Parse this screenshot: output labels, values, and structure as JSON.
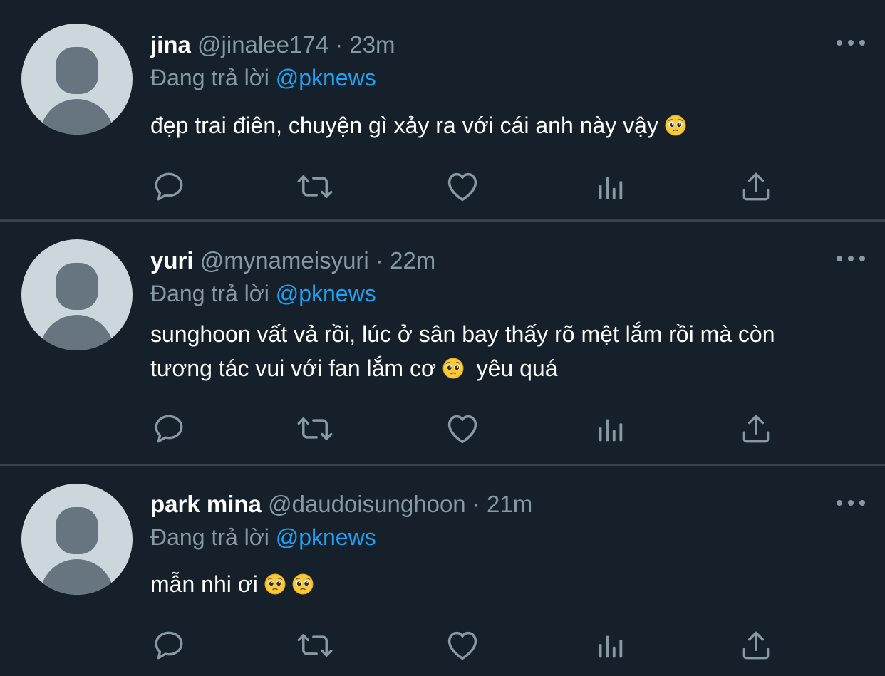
{
  "colors": {
    "background": "#15202b",
    "divider": "#38444d",
    "secondary_text": "#8899a6",
    "link": "#1da1f2",
    "avatar_bg": "#ccd6dd",
    "avatar_fg": "#66757f"
  },
  "icons": {
    "more": "more-horizontal-icon",
    "reply": "reply-icon",
    "retweet": "retweet-icon",
    "like": "heart-icon",
    "analytics": "analytics-icon",
    "share": "share-icon",
    "emoji": "pleading-face-emoji"
  },
  "tweets": [
    {
      "name": "jina",
      "handle": "@jinalee174",
      "separator": "·",
      "time": "23m",
      "reply_label": "Đang trả lời",
      "reply_to": "@pknews",
      "text_line1": "đẹp trai điên, chuyện gì xảy ra với cái anh này vậy",
      "text_line2": ""
    },
    {
      "name": "yuri",
      "handle": "@mynameisyuri",
      "separator": "·",
      "time": "22m",
      "reply_label": "Đang trả lời",
      "reply_to": "@pknews",
      "text_line1": "sunghoon vất vả rồi, lúc ở sân bay thấy rõ mệt lắm rồi mà còn",
      "text_line2a": "tương tác vui với fan lắm cơ",
      "text_line2b": "yêu quá"
    },
    {
      "name": "park mina",
      "handle": "@daudoisunghoon",
      "separator": "·",
      "time": "21m",
      "reply_label": "Đang trả lời",
      "reply_to": "@pknews",
      "text_line1": "mẫn nhi ơi",
      "text_line2": ""
    }
  ]
}
